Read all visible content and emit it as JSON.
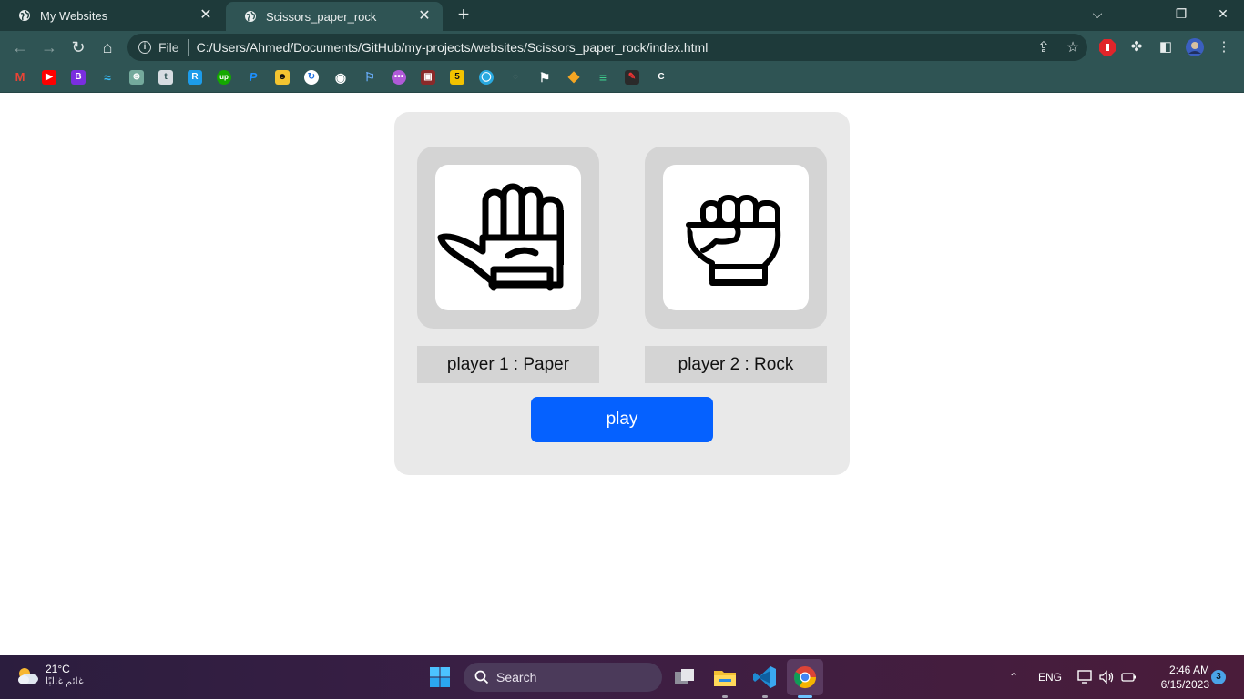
{
  "browser": {
    "tabs": [
      {
        "title": "My Websites",
        "active": false
      },
      {
        "title": "Scissors_paper_rock",
        "active": true
      }
    ],
    "address": {
      "scheme": "File",
      "url": "C:/Users/Ahmed/Documents/GitHub/my-projects/websites/Scissors_paper_rock/index.html"
    },
    "bookmark_labels": [
      "M",
      "B",
      "t",
      "R",
      "up",
      "P",
      "5",
      "C"
    ]
  },
  "game": {
    "player1": {
      "label": "player 1 : Paper",
      "hand": "paper"
    },
    "player2": {
      "label": "player 2 : Rock",
      "hand": "rock"
    },
    "play_label": "play"
  },
  "taskbar": {
    "weather": {
      "temp": "21°C",
      "condition": "غائم غالبًا"
    },
    "search_label": "Search",
    "language": "ENG",
    "time": "2:46 AM",
    "date": "6/15/2023",
    "notification_count": "3"
  },
  "colors": {
    "tabbar": "#1e3a3a",
    "toolbar": "#2f5454",
    "card": "#e9e9e9",
    "frame": "#d4d4d4",
    "play_button": "#0561ff"
  }
}
